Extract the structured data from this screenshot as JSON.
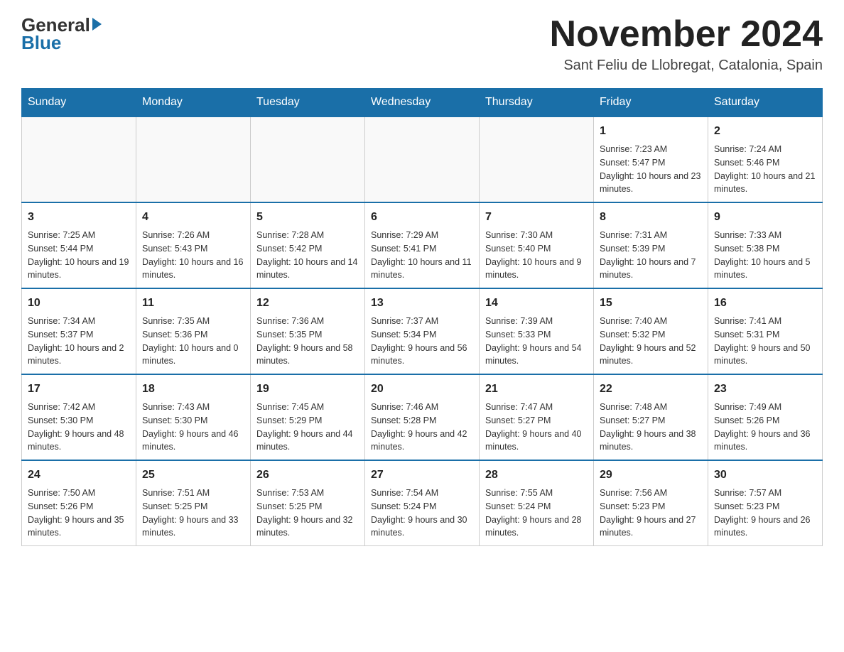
{
  "header": {
    "logo_line1": "General",
    "logo_line2": "Blue",
    "month_title": "November 2024",
    "location": "Sant Feliu de Llobregat, Catalonia, Spain"
  },
  "weekdays": [
    "Sunday",
    "Monday",
    "Tuesday",
    "Wednesday",
    "Thursday",
    "Friday",
    "Saturday"
  ],
  "weeks": [
    [
      {
        "day": "",
        "sunrise": "",
        "sunset": "",
        "daylight": ""
      },
      {
        "day": "",
        "sunrise": "",
        "sunset": "",
        "daylight": ""
      },
      {
        "day": "",
        "sunrise": "",
        "sunset": "",
        "daylight": ""
      },
      {
        "day": "",
        "sunrise": "",
        "sunset": "",
        "daylight": ""
      },
      {
        "day": "",
        "sunrise": "",
        "sunset": "",
        "daylight": ""
      },
      {
        "day": "1",
        "sunrise": "Sunrise: 7:23 AM",
        "sunset": "Sunset: 5:47 PM",
        "daylight": "Daylight: 10 hours and 23 minutes."
      },
      {
        "day": "2",
        "sunrise": "Sunrise: 7:24 AM",
        "sunset": "Sunset: 5:46 PM",
        "daylight": "Daylight: 10 hours and 21 minutes."
      }
    ],
    [
      {
        "day": "3",
        "sunrise": "Sunrise: 7:25 AM",
        "sunset": "Sunset: 5:44 PM",
        "daylight": "Daylight: 10 hours and 19 minutes."
      },
      {
        "day": "4",
        "sunrise": "Sunrise: 7:26 AM",
        "sunset": "Sunset: 5:43 PM",
        "daylight": "Daylight: 10 hours and 16 minutes."
      },
      {
        "day": "5",
        "sunrise": "Sunrise: 7:28 AM",
        "sunset": "Sunset: 5:42 PM",
        "daylight": "Daylight: 10 hours and 14 minutes."
      },
      {
        "day": "6",
        "sunrise": "Sunrise: 7:29 AM",
        "sunset": "Sunset: 5:41 PM",
        "daylight": "Daylight: 10 hours and 11 minutes."
      },
      {
        "day": "7",
        "sunrise": "Sunrise: 7:30 AM",
        "sunset": "Sunset: 5:40 PM",
        "daylight": "Daylight: 10 hours and 9 minutes."
      },
      {
        "day": "8",
        "sunrise": "Sunrise: 7:31 AM",
        "sunset": "Sunset: 5:39 PM",
        "daylight": "Daylight: 10 hours and 7 minutes."
      },
      {
        "day": "9",
        "sunrise": "Sunrise: 7:33 AM",
        "sunset": "Sunset: 5:38 PM",
        "daylight": "Daylight: 10 hours and 5 minutes."
      }
    ],
    [
      {
        "day": "10",
        "sunrise": "Sunrise: 7:34 AM",
        "sunset": "Sunset: 5:37 PM",
        "daylight": "Daylight: 10 hours and 2 minutes."
      },
      {
        "day": "11",
        "sunrise": "Sunrise: 7:35 AM",
        "sunset": "Sunset: 5:36 PM",
        "daylight": "Daylight: 10 hours and 0 minutes."
      },
      {
        "day": "12",
        "sunrise": "Sunrise: 7:36 AM",
        "sunset": "Sunset: 5:35 PM",
        "daylight": "Daylight: 9 hours and 58 minutes."
      },
      {
        "day": "13",
        "sunrise": "Sunrise: 7:37 AM",
        "sunset": "Sunset: 5:34 PM",
        "daylight": "Daylight: 9 hours and 56 minutes."
      },
      {
        "day": "14",
        "sunrise": "Sunrise: 7:39 AM",
        "sunset": "Sunset: 5:33 PM",
        "daylight": "Daylight: 9 hours and 54 minutes."
      },
      {
        "day": "15",
        "sunrise": "Sunrise: 7:40 AM",
        "sunset": "Sunset: 5:32 PM",
        "daylight": "Daylight: 9 hours and 52 minutes."
      },
      {
        "day": "16",
        "sunrise": "Sunrise: 7:41 AM",
        "sunset": "Sunset: 5:31 PM",
        "daylight": "Daylight: 9 hours and 50 minutes."
      }
    ],
    [
      {
        "day": "17",
        "sunrise": "Sunrise: 7:42 AM",
        "sunset": "Sunset: 5:30 PM",
        "daylight": "Daylight: 9 hours and 48 minutes."
      },
      {
        "day": "18",
        "sunrise": "Sunrise: 7:43 AM",
        "sunset": "Sunset: 5:30 PM",
        "daylight": "Daylight: 9 hours and 46 minutes."
      },
      {
        "day": "19",
        "sunrise": "Sunrise: 7:45 AM",
        "sunset": "Sunset: 5:29 PM",
        "daylight": "Daylight: 9 hours and 44 minutes."
      },
      {
        "day": "20",
        "sunrise": "Sunrise: 7:46 AM",
        "sunset": "Sunset: 5:28 PM",
        "daylight": "Daylight: 9 hours and 42 minutes."
      },
      {
        "day": "21",
        "sunrise": "Sunrise: 7:47 AM",
        "sunset": "Sunset: 5:27 PM",
        "daylight": "Daylight: 9 hours and 40 minutes."
      },
      {
        "day": "22",
        "sunrise": "Sunrise: 7:48 AM",
        "sunset": "Sunset: 5:27 PM",
        "daylight": "Daylight: 9 hours and 38 minutes."
      },
      {
        "day": "23",
        "sunrise": "Sunrise: 7:49 AM",
        "sunset": "Sunset: 5:26 PM",
        "daylight": "Daylight: 9 hours and 36 minutes."
      }
    ],
    [
      {
        "day": "24",
        "sunrise": "Sunrise: 7:50 AM",
        "sunset": "Sunset: 5:26 PM",
        "daylight": "Daylight: 9 hours and 35 minutes."
      },
      {
        "day": "25",
        "sunrise": "Sunrise: 7:51 AM",
        "sunset": "Sunset: 5:25 PM",
        "daylight": "Daylight: 9 hours and 33 minutes."
      },
      {
        "day": "26",
        "sunrise": "Sunrise: 7:53 AM",
        "sunset": "Sunset: 5:25 PM",
        "daylight": "Daylight: 9 hours and 32 minutes."
      },
      {
        "day": "27",
        "sunrise": "Sunrise: 7:54 AM",
        "sunset": "Sunset: 5:24 PM",
        "daylight": "Daylight: 9 hours and 30 minutes."
      },
      {
        "day": "28",
        "sunrise": "Sunrise: 7:55 AM",
        "sunset": "Sunset: 5:24 PM",
        "daylight": "Daylight: 9 hours and 28 minutes."
      },
      {
        "day": "29",
        "sunrise": "Sunrise: 7:56 AM",
        "sunset": "Sunset: 5:23 PM",
        "daylight": "Daylight: 9 hours and 27 minutes."
      },
      {
        "day": "30",
        "sunrise": "Sunrise: 7:57 AM",
        "sunset": "Sunset: 5:23 PM",
        "daylight": "Daylight: 9 hours and 26 minutes."
      }
    ]
  ]
}
